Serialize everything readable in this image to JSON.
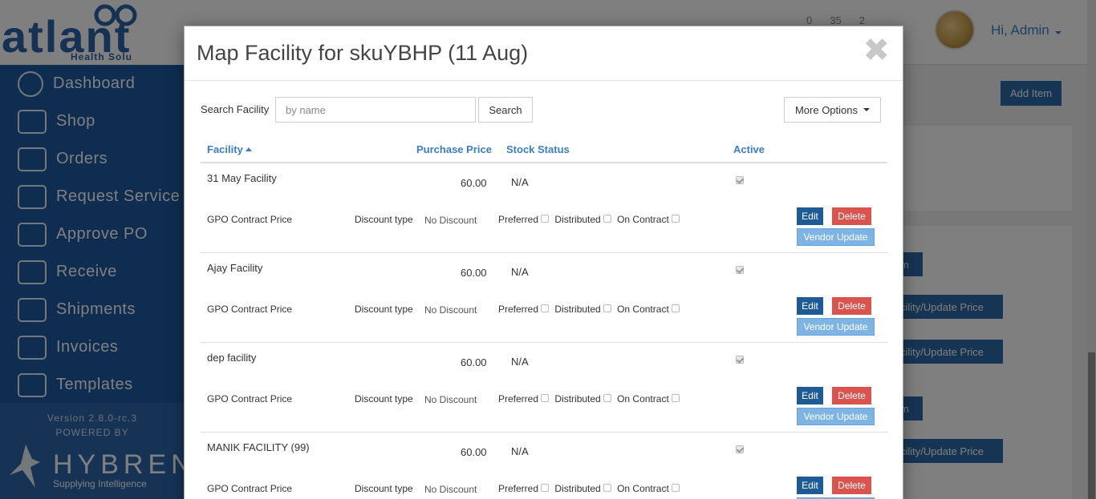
{
  "app": {
    "logo_word": "atlant",
    "logo_sub": "Health Solu",
    "counters": [
      "0",
      "35",
      "2"
    ],
    "greeting": "Hi, Admin",
    "sidebar": [
      {
        "label": "Dashboard",
        "icon": "dashboard-icon"
      },
      {
        "label": "Shop",
        "icon": "cart-icon"
      },
      {
        "label": "Orders",
        "icon": "orders-icon"
      },
      {
        "label": "Request Service",
        "icon": "request-service-icon"
      },
      {
        "label": "Approve PO",
        "icon": "approve-po-icon"
      },
      {
        "label": "Receive",
        "icon": "receive-icon"
      },
      {
        "label": "Shipments",
        "icon": "truck-icon"
      },
      {
        "label": "Invoices",
        "icon": "invoice-icon"
      },
      {
        "label": "Templates",
        "icon": "template-icon"
      }
    ],
    "version": "Version 2.8.0-rc.3",
    "powered_by": "POWERED BY",
    "hybrent": "HYBRENT",
    "hybrent_sub": "Supplying Intelligence",
    "add_item": "Add Item",
    "bg_buttons": [
      "m",
      "cility/Update Price",
      "cility/Update Price",
      "m",
      "cility/Update Price"
    ]
  },
  "modal": {
    "title": "Map Facility for skuYBHP (11 Aug)",
    "close": "✖",
    "search_label": "Search Facility",
    "search_placeholder": "by name",
    "search_button": "Search",
    "more_options": "More Options",
    "columns": {
      "facility": "Facility",
      "purchase_price": "Purchase Price",
      "stock_status": "Stock Status",
      "active": "Active"
    },
    "row_labels": {
      "gpo": "GPO Contract Price",
      "discount_type": "Discount type",
      "preferred": "Preferred",
      "distributed": "Distributed",
      "on_contract": "On Contract",
      "edit": "Edit",
      "delete": "Delete",
      "vendor_update": "Vendor Update"
    },
    "rows": [
      {
        "facility": "31 May Facility",
        "price": "60.00",
        "stock": "N/A",
        "discount": "No Discount",
        "active": true
      },
      {
        "facility": "Ajay Facility",
        "price": "60.00",
        "stock": "N/A",
        "discount": "No Discount",
        "active": true
      },
      {
        "facility": "dep facility",
        "price": "60.00",
        "stock": "N/A",
        "discount": "No Discount",
        "active": true
      },
      {
        "facility": "MANIK FACILITY (99)",
        "price": "60.00",
        "stock": "N/A",
        "discount": "No Discount",
        "active": true
      }
    ]
  }
}
